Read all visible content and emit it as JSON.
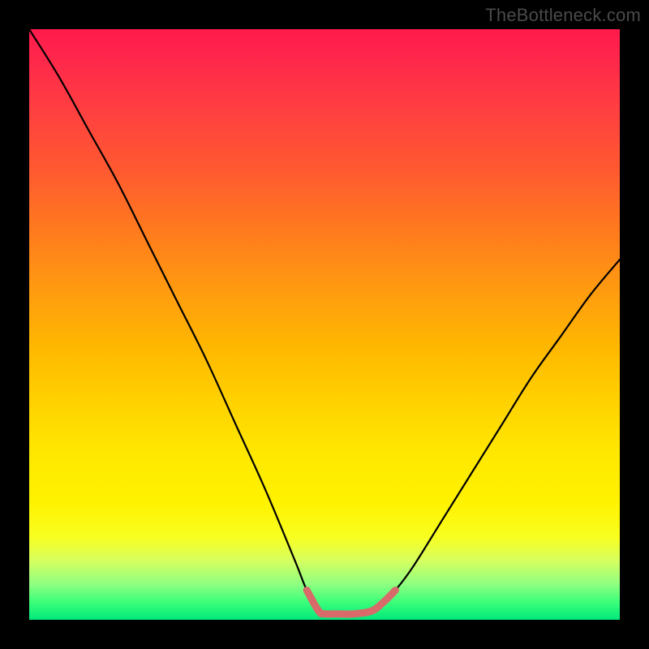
{
  "watermark": {
    "text": "TheBottleneck.com"
  },
  "chart_data": {
    "type": "line",
    "title": "",
    "xlabel": "",
    "ylabel": "",
    "xlim": [
      0,
      100
    ],
    "ylim": [
      0,
      100
    ],
    "grid": false,
    "background_gradient": "vertical red→orange→yellow→green",
    "series": [
      {
        "name": "bottleneck-curve",
        "color": "#000000",
        "x": [
          0,
          5,
          10,
          15,
          20,
          25,
          30,
          35,
          40,
          45,
          47,
          49,
          50,
          52,
          55,
          58,
          60,
          62,
          65,
          70,
          75,
          80,
          85,
          90,
          95,
          100
        ],
        "y": [
          100,
          92,
          83,
          74,
          64,
          54,
          44,
          33,
          22,
          10,
          5,
          1.5,
          1,
          1,
          1,
          1.5,
          3,
          5,
          9,
          17,
          25,
          33,
          41,
          48,
          55,
          61
        ]
      },
      {
        "name": "sweet-spot-band",
        "color": "#d86a6a",
        "x": [
          47,
          49,
          50,
          52,
          55,
          58,
          60,
          62
        ],
        "y": [
          5,
          1.5,
          1,
          1,
          1,
          1.5,
          3,
          5
        ]
      }
    ]
  }
}
